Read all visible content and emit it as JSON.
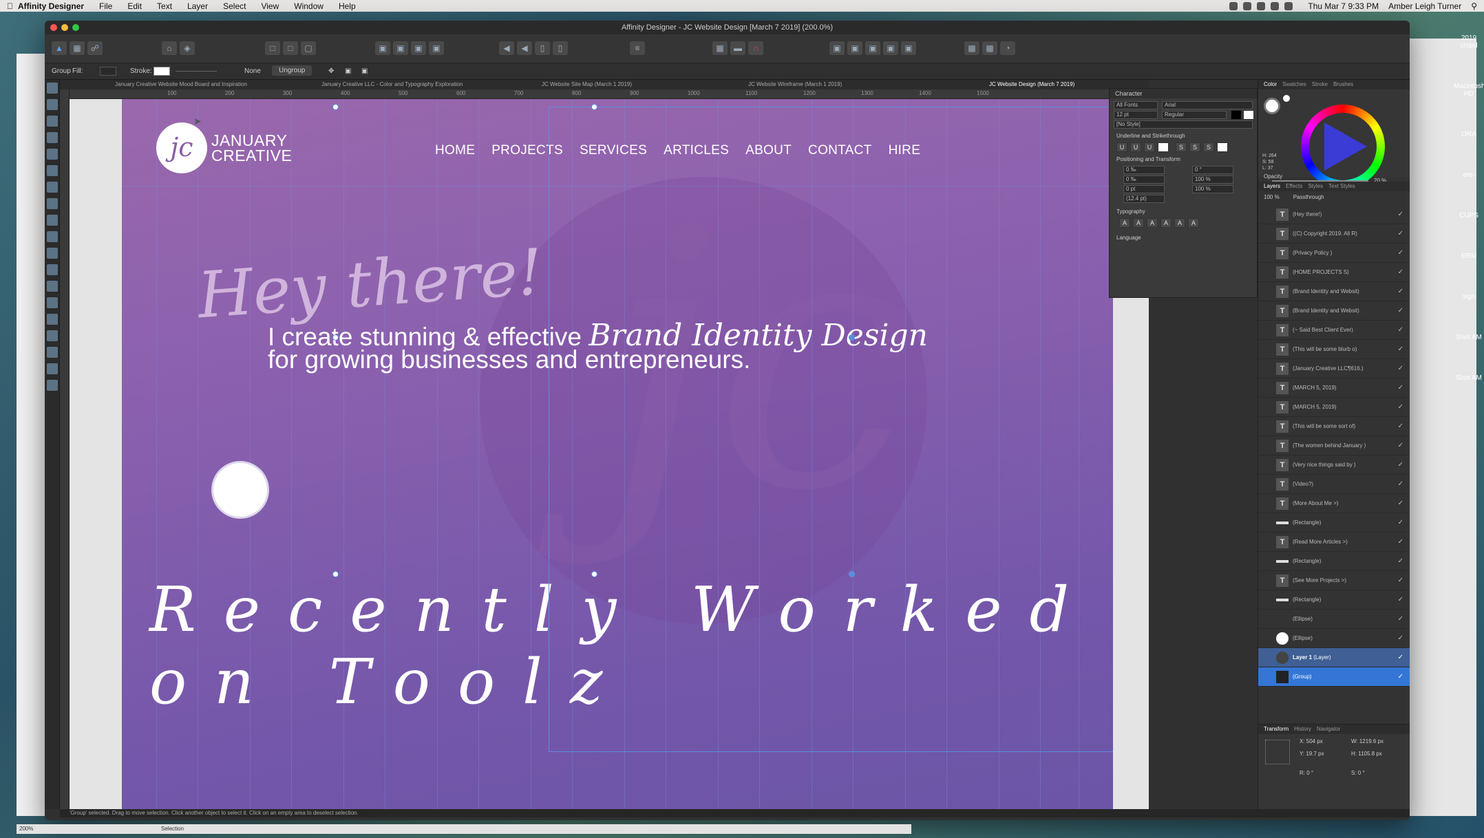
{
  "menubar": {
    "app_name": "Affinity Designer",
    "items": [
      "File",
      "Edit",
      "Text",
      "Layer",
      "Select",
      "View",
      "Window",
      "Help"
    ],
    "datetime": "Thu Mar 7  9:33 PM",
    "user": "Amber Leigh Turner"
  },
  "window": {
    "title": "Affinity Designer - JC Website Design [March 7 2019] (200.0%)"
  },
  "context_toolbar": {
    "group_label": "Group",
    "fill_label": "Fill:",
    "stroke_label": "Stroke:",
    "stroke_value": "None",
    "ungroup_label": "Ungroup"
  },
  "doc_tabs": [
    "January Creative Website Mood Board and Inspiration",
    "January Creative LLC - Color and Typography Exploration",
    "JC Website Site Map (March 1 2019)",
    "JC Website Wireframe (March 1 2019)",
    "JC Website Design (March 7 2019)"
  ],
  "ruler": [
    "100",
    "200",
    "300",
    "400",
    "500",
    "600",
    "700",
    "800",
    "900",
    "1000",
    "1100",
    "1200",
    "1300",
    "1400",
    "1500"
  ],
  "artboard": {
    "logo_mark": "jc",
    "logo_line1": "JANUARY",
    "logo_line2": "CREATIVE",
    "nav": [
      "HOME",
      "PROJECTS",
      "SERVICES",
      "ARTICLES",
      "ABOUT",
      "CONTACT",
      "HIRE"
    ],
    "hey": "Hey there!",
    "line1_text": "I create stunning & effective",
    "line1_script": "Brand Identity Design",
    "line2_text": "for growing businesses and entrepreneurs.",
    "bottom_script": "Recently Worked on Toolz"
  },
  "status_hint": "'Group' selected. Drag to move selection. Click another object to select it. Click on an empty area to deselect selection.",
  "zoom": "200%",
  "tool_name": "Selection",
  "character_panel": {
    "title": "Character",
    "font_collection": "All Fonts",
    "font_family": "Arial",
    "font_size": "12 pt",
    "font_style": "Regular",
    "style": "[No Style]",
    "section_underline": "Underline and Strikethrough",
    "section_positioning": "Positioning and Transform",
    "tracking": "0 ‰",
    "kerning": "0 ‰",
    "baseline": "0 pt",
    "leading": "(12.4 pt)",
    "shear": "0 °",
    "vscale": "100 %",
    "hscale": "100 %",
    "section_typography": "Typography",
    "section_language": "Language"
  },
  "right_panel": {
    "color_tabs": [
      "Color",
      "Swatches",
      "Stroke",
      "Brushes"
    ],
    "hsl": [
      "H: 264",
      "S: 58",
      "L: 37"
    ],
    "opacity_label": "Opacity",
    "opacity_value": "20 %",
    "layer_tabs": [
      "Layers",
      "Effects",
      "Styles",
      "Text Styles"
    ],
    "layer_opacity": "100 %",
    "blend_mode": "Passthrough",
    "layers": [
      "(Hey there!)",
      "((C) Copyright 2019. All R)",
      "(Privacy Policy )",
      "(HOME     PROJECTS     S)",
      "(Brand Identity and Websit)",
      "(Brand Identity and Websit)",
      "(~ Said Best Client Ever)",
      "(This will be some blurb o)",
      "(January Creative LLC¶616.)",
      "(MARCH 5, 2019)",
      "(MARCH 5, 2019)",
      "(This will be some sort of)",
      "(The women behind January )",
      "(Very nice things said by )",
      "(Video?)",
      "(More About Me >)",
      "(Rectangle)",
      "(Read More Articles >)",
      "(Rectangle)",
      "(See More Projects >)",
      "(Rectangle)",
      "(Ellipse)",
      "(Ellipse)"
    ],
    "layer_parent": "Layer 1",
    "layer_parent_type": "(Layer)",
    "layer_group": "(Group)",
    "transform_tabs": [
      "Transform",
      "History",
      "Navigator"
    ],
    "transform": {
      "x": "504 px",
      "y": "19.7 px",
      "w": "1219.6 px",
      "h": "1105.8 px",
      "r": "0 °",
      "s": "0 °"
    }
  },
  "desktop_labels": [
    "2019 cropd",
    "Macintosh HD",
    "ORA",
    "are-",
    "CUPS",
    "ERM",
    "sign",
    "Shot AM",
    "Shot AM"
  ],
  "colors": {
    "artboard_top": "#9a68ad",
    "artboard_bottom": "#6b55a6",
    "selection": "#5a8ee0",
    "ui_dark": "#303030"
  }
}
